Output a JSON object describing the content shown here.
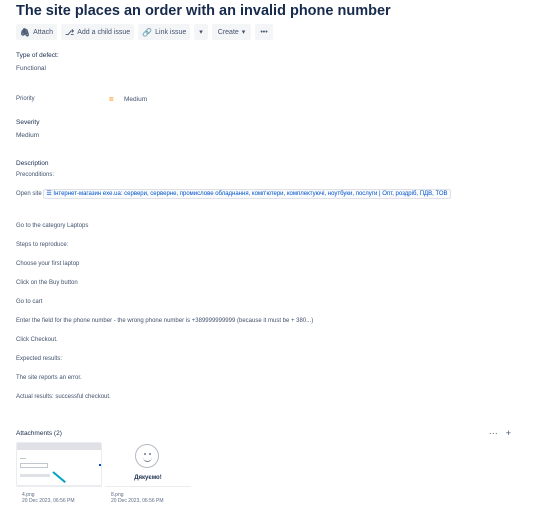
{
  "issue": {
    "title": "The site places an order with an invalid phone number"
  },
  "toolbar": {
    "attach": "Attach",
    "add_child": "Add a child issue",
    "link_issue": "Link issue",
    "dropdown": "▾",
    "create": "Create",
    "more": "•••"
  },
  "fields": {
    "type_label": "Type of defect:",
    "type_value": "Functional",
    "priority_label": "Priority",
    "priority_icon": "=",
    "priority_value": "Medium",
    "severity_label": "Severity",
    "severity_value": "Medium"
  },
  "description": {
    "label": "Description",
    "preconditions": "Preconditions:",
    "open_site": "Open site",
    "link_text": "Інтернет-магазин exe.ua: сервери, серверне, промислове обладнання, комп'ютери, комплектуючі, ноутбуки, послуги | Опт, роздріб, ПДВ, ТОВ",
    "lines": [
      "Go to the category Laptops",
      "Steps to reproduce:",
      "Choose your first laptop",
      "Click on the Buy button",
      "Go to cart",
      "Enter the field for the phone number - the wrong phone number is +389999999999 (because it must be + 380...)",
      "Click Checkout.",
      "Expected results:",
      "The site reports an error.",
      "Actual results: successful checkout."
    ]
  },
  "attachments": {
    "header": "Attachments (2)",
    "more": "···",
    "add": "+",
    "items": [
      {
        "name": "4.png",
        "date": "20 Dec 2023, 06:56 PM"
      },
      {
        "name": "8.png",
        "date": "20 Dec 2023, 06:56 PM",
        "caption": "Дякуємо!"
      }
    ]
  }
}
